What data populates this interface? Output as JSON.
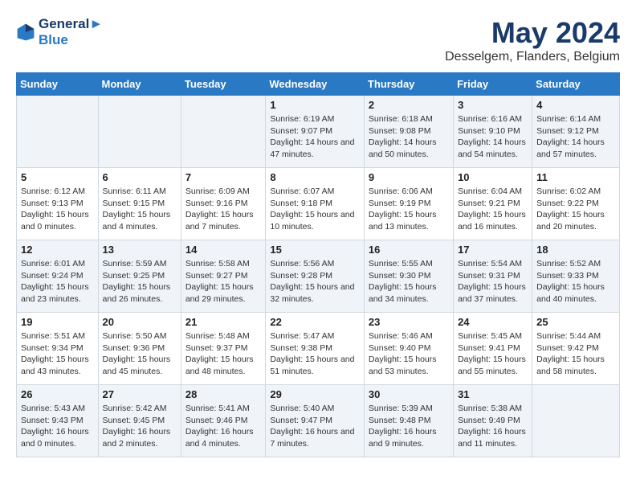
{
  "header": {
    "logo_line1": "General",
    "logo_line2": "Blue",
    "title": "May 2024",
    "subtitle": "Desselgem, Flanders, Belgium"
  },
  "weekdays": [
    "Sunday",
    "Monday",
    "Tuesday",
    "Wednesday",
    "Thursday",
    "Friday",
    "Saturday"
  ],
  "weeks": [
    [
      {
        "day": "",
        "content": ""
      },
      {
        "day": "",
        "content": ""
      },
      {
        "day": "",
        "content": ""
      },
      {
        "day": "1",
        "content": "Sunrise: 6:19 AM\nSunset: 9:07 PM\nDaylight: 14 hours and 47 minutes."
      },
      {
        "day": "2",
        "content": "Sunrise: 6:18 AM\nSunset: 9:08 PM\nDaylight: 14 hours and 50 minutes."
      },
      {
        "day": "3",
        "content": "Sunrise: 6:16 AM\nSunset: 9:10 PM\nDaylight: 14 hours and 54 minutes."
      },
      {
        "day": "4",
        "content": "Sunrise: 6:14 AM\nSunset: 9:12 PM\nDaylight: 14 hours and 57 minutes."
      }
    ],
    [
      {
        "day": "5",
        "content": "Sunrise: 6:12 AM\nSunset: 9:13 PM\nDaylight: 15 hours and 0 minutes."
      },
      {
        "day": "6",
        "content": "Sunrise: 6:11 AM\nSunset: 9:15 PM\nDaylight: 15 hours and 4 minutes."
      },
      {
        "day": "7",
        "content": "Sunrise: 6:09 AM\nSunset: 9:16 PM\nDaylight: 15 hours and 7 minutes."
      },
      {
        "day": "8",
        "content": "Sunrise: 6:07 AM\nSunset: 9:18 PM\nDaylight: 15 hours and 10 minutes."
      },
      {
        "day": "9",
        "content": "Sunrise: 6:06 AM\nSunset: 9:19 PM\nDaylight: 15 hours and 13 minutes."
      },
      {
        "day": "10",
        "content": "Sunrise: 6:04 AM\nSunset: 9:21 PM\nDaylight: 15 hours and 16 minutes."
      },
      {
        "day": "11",
        "content": "Sunrise: 6:02 AM\nSunset: 9:22 PM\nDaylight: 15 hours and 20 minutes."
      }
    ],
    [
      {
        "day": "12",
        "content": "Sunrise: 6:01 AM\nSunset: 9:24 PM\nDaylight: 15 hours and 23 minutes."
      },
      {
        "day": "13",
        "content": "Sunrise: 5:59 AM\nSunset: 9:25 PM\nDaylight: 15 hours and 26 minutes."
      },
      {
        "day": "14",
        "content": "Sunrise: 5:58 AM\nSunset: 9:27 PM\nDaylight: 15 hours and 29 minutes."
      },
      {
        "day": "15",
        "content": "Sunrise: 5:56 AM\nSunset: 9:28 PM\nDaylight: 15 hours and 32 minutes."
      },
      {
        "day": "16",
        "content": "Sunrise: 5:55 AM\nSunset: 9:30 PM\nDaylight: 15 hours and 34 minutes."
      },
      {
        "day": "17",
        "content": "Sunrise: 5:54 AM\nSunset: 9:31 PM\nDaylight: 15 hours and 37 minutes."
      },
      {
        "day": "18",
        "content": "Sunrise: 5:52 AM\nSunset: 9:33 PM\nDaylight: 15 hours and 40 minutes."
      }
    ],
    [
      {
        "day": "19",
        "content": "Sunrise: 5:51 AM\nSunset: 9:34 PM\nDaylight: 15 hours and 43 minutes."
      },
      {
        "day": "20",
        "content": "Sunrise: 5:50 AM\nSunset: 9:36 PM\nDaylight: 15 hours and 45 minutes."
      },
      {
        "day": "21",
        "content": "Sunrise: 5:48 AM\nSunset: 9:37 PM\nDaylight: 15 hours and 48 minutes."
      },
      {
        "day": "22",
        "content": "Sunrise: 5:47 AM\nSunset: 9:38 PM\nDaylight: 15 hours and 51 minutes."
      },
      {
        "day": "23",
        "content": "Sunrise: 5:46 AM\nSunset: 9:40 PM\nDaylight: 15 hours and 53 minutes."
      },
      {
        "day": "24",
        "content": "Sunrise: 5:45 AM\nSunset: 9:41 PM\nDaylight: 15 hours and 55 minutes."
      },
      {
        "day": "25",
        "content": "Sunrise: 5:44 AM\nSunset: 9:42 PM\nDaylight: 15 hours and 58 minutes."
      }
    ],
    [
      {
        "day": "26",
        "content": "Sunrise: 5:43 AM\nSunset: 9:43 PM\nDaylight: 16 hours and 0 minutes."
      },
      {
        "day": "27",
        "content": "Sunrise: 5:42 AM\nSunset: 9:45 PM\nDaylight: 16 hours and 2 minutes."
      },
      {
        "day": "28",
        "content": "Sunrise: 5:41 AM\nSunset: 9:46 PM\nDaylight: 16 hours and 4 minutes."
      },
      {
        "day": "29",
        "content": "Sunrise: 5:40 AM\nSunset: 9:47 PM\nDaylight: 16 hours and 7 minutes."
      },
      {
        "day": "30",
        "content": "Sunrise: 5:39 AM\nSunset: 9:48 PM\nDaylight: 16 hours and 9 minutes."
      },
      {
        "day": "31",
        "content": "Sunrise: 5:38 AM\nSunset: 9:49 PM\nDaylight: 16 hours and 11 minutes."
      },
      {
        "day": "",
        "content": ""
      }
    ]
  ]
}
